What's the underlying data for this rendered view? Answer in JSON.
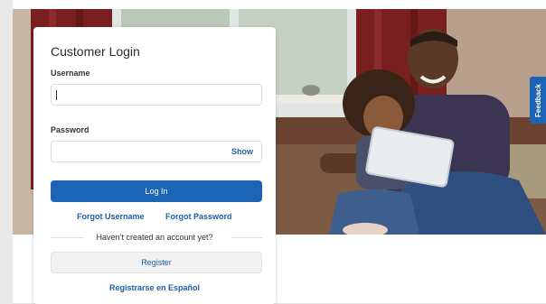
{
  "login": {
    "title": "Customer Login",
    "username_label": "Username",
    "username_value": "",
    "password_label": "Password",
    "password_value": "",
    "show_label": "Show",
    "login_button": "Log In",
    "forgot_username": "Forgot Username",
    "forgot_password": "Forgot Password",
    "no_account_text": "Haven’t created an account yet?",
    "register_button": "Register",
    "spanish_link": "Registrarse en Español"
  },
  "feedback": {
    "label": "Feedback"
  },
  "colors": {
    "primary": "#1c64b6",
    "link": "#1d5fa8"
  },
  "icons": {
    "hero": "family-tablet-photo"
  }
}
